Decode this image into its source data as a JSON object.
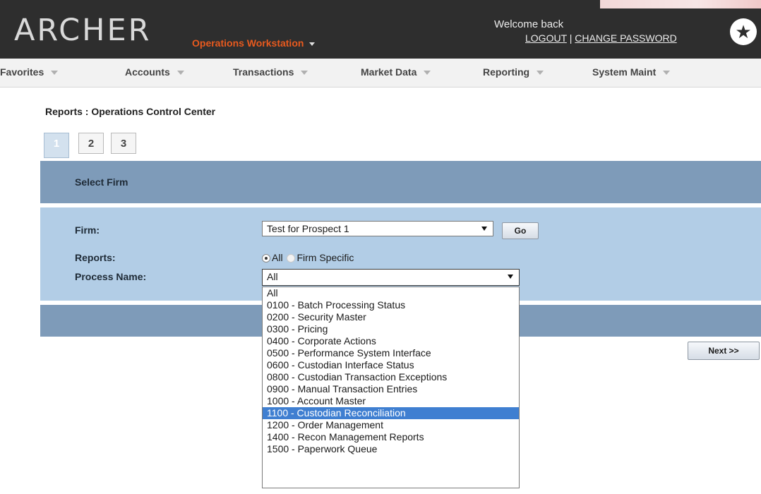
{
  "header": {
    "logo": "ARCHER",
    "workstation": "Operations Workstation",
    "welcome": "Welcome back",
    "logout": "LOGOUT",
    "separator": "|",
    "change_password": "CHANGE PASSWORD",
    "star": "★"
  },
  "nav": {
    "items": [
      {
        "label": "Favorites"
      },
      {
        "label": "Accounts"
      },
      {
        "label": "Transactions"
      },
      {
        "label": "Market Data"
      },
      {
        "label": "Reporting"
      },
      {
        "label": "System Maint"
      }
    ]
  },
  "page": {
    "title": "Reports : Operations Control Center",
    "tabs": [
      "1",
      "2",
      "3"
    ],
    "active_tab": "1",
    "section_title": "Select Firm"
  },
  "form": {
    "firm_label": "Firm:",
    "firm_value": "Test for Prospect 1",
    "go_label": "Go",
    "reports_label": "Reports:",
    "reports_option_all": "All",
    "reports_option_firm": "Firm Specific",
    "reports_selected": "All",
    "process_label": "Process Name:",
    "process_value": "All",
    "next_label": "Next >>"
  },
  "process_options": [
    "All",
    "0100 - Batch Processing Status",
    "0200 - Security Master",
    "0300 - Pricing",
    "0400 - Corporate Actions",
    "0500 - Performance System Interface",
    "0600 - Custodian Interface Status",
    "0800 - Custodian Transaction Exceptions",
    "0900 - Manual Transaction Entries",
    "1000 - Account Master",
    "1100 - Custodian Reconciliation",
    "1200 - Order Management",
    "1400 - Recon Management Reports",
    "1500 - Paperwork Queue"
  ],
  "highlighted_option": "1100 - Custodian Reconciliation",
  "colors": {
    "header_bg": "#2e2e2e",
    "brand_orange": "#e85a1e",
    "panel_dark": "#7e9bb9",
    "panel_light": "#b2cde6",
    "highlight": "#3f7fd1"
  }
}
